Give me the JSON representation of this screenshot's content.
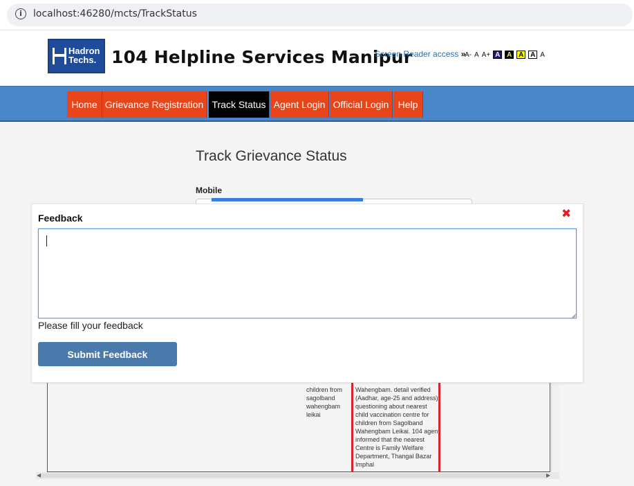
{
  "browser": {
    "url": "localhost:46280/mcts/TrackStatus",
    "info_icon": "info-icon"
  },
  "header": {
    "logo_text_line1": "Hadron",
    "logo_text_line2": "Techs.",
    "site_title": "104 Helpline Services Manipur",
    "screen_reader": "Screen Reader access",
    "screen_reader_arrow": "»",
    "font_controls": [
      "A-",
      "A",
      "A+"
    ],
    "contrast_swatches": [
      "A",
      "A",
      "A",
      "A",
      "A"
    ]
  },
  "nav": {
    "items": [
      {
        "label": "Home",
        "active": false
      },
      {
        "label": "Grievance Registration",
        "active": false
      },
      {
        "label": "Track Status",
        "active": true
      },
      {
        "label": "Agent Login",
        "active": false
      },
      {
        "label": "Official Login",
        "active": false
      },
      {
        "label": "Help",
        "active": false
      }
    ]
  },
  "main": {
    "title": "Track Grievance Status",
    "mobile_label": "Mobile"
  },
  "table": {
    "col_a_lines": [
      "children from",
      "sagolband",
      "wahengbam",
      "leikai"
    ],
    "col_b_lines": [
      "Wahengbam. detail verified",
      "(Aadhar, age-25 and address)",
      "questioning about nearest",
      "child vaccination centre for",
      "children from Sagolband",
      "Wahengbam Leikai. 104 agent",
      "informed that the nearest",
      "Centre is Family Welfare",
      "Department, Thangal Bazar",
      "Imphal"
    ]
  },
  "modal": {
    "title": "Feedback",
    "close_glyph": "✖",
    "textarea_value": "",
    "hint": "Please fill your feedback",
    "submit_label": "Submit Feedback"
  },
  "colors": {
    "nav_bg": "#4a87c9",
    "nav_item": "#e8451a",
    "nav_active": "#000000",
    "submit_bg": "#4a79ac",
    "highlight_border": "#d9252b"
  }
}
